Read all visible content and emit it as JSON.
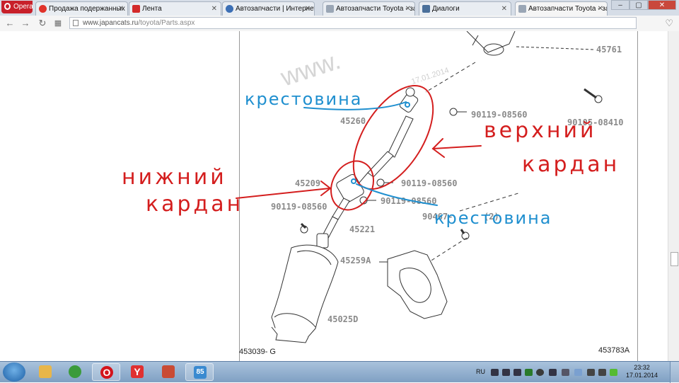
{
  "browser": {
    "menu_label": "Opera",
    "tabs": [
      {
        "title": "Продажа подержанных в",
        "icon": "drom-icon",
        "color": "#e0322a",
        "active": false
      },
      {
        "title": "Лента",
        "icon": "drive2-icon",
        "color": "#d32a2a",
        "active": false
      },
      {
        "title": "Автозапчасти | Интернет",
        "icon": "globe-icon",
        "color": "#3c6fb5",
        "active": false
      },
      {
        "title": "Автозапчасти Toyota - за",
        "icon": "page-icon",
        "color": "#9aa6b5",
        "active": false
      },
      {
        "title": "Диалоги",
        "icon": "vk-icon",
        "color": "#4a6f9a",
        "active": false
      },
      {
        "title": "Автозапчасти Toyota - за",
        "icon": "page-icon",
        "color": "#9aa6b5",
        "active": true
      }
    ],
    "address": {
      "host": "www.japancats.ru",
      "path": "/toyota/Parts.aspx"
    }
  },
  "diagram": {
    "watermark": "www.",
    "watermark_date": "17.01.2014",
    "part_numbers": {
      "p45761": "45761",
      "p45260": "45260",
      "p90119_a": "90119-08560",
      "p90105": "90105-08410",
      "p45209": "45209",
      "p90119_b": "90119-08560",
      "p90119_c": "90119-08560",
      "p90119_d": "90119-08560",
      "p90467": "90467-",
      "p90467_tail": "(2)",
      "p45221": "45221",
      "p45259A": "45259A",
      "p45025D": "45025D",
      "ref_left": "453039- G",
      "ref_right": "453783A"
    },
    "annotations": {
      "upper_cross": "крестовина",
      "upper_cardan_1": "верхний",
      "upper_cardan_2": "кардан",
      "lower_cardan_1": "нижний",
      "lower_cardan_2": "кардан",
      "lower_cross": "крестовина"
    },
    "colors": {
      "annotation_red": "#d41e1e",
      "annotation_blue": "#1f8fcf"
    }
  },
  "taskbar": {
    "apps": [
      {
        "name": "explorer",
        "icon": "folder-icon",
        "color": "#e8b64a",
        "glyph": ""
      },
      {
        "name": "chrome",
        "icon": "chrome-icon",
        "color": "#3b9b3b",
        "glyph": ""
      },
      {
        "name": "opera",
        "icon": "opera-icon",
        "color": "#d3141b",
        "glyph": "O"
      },
      {
        "name": "yandex",
        "icon": "yandex-browser-icon",
        "color": "#e03030",
        "glyph": "Y"
      },
      {
        "name": "app5",
        "icon": "app-icon",
        "color": "#c94b34",
        "glyph": ""
      },
      {
        "name": "app6",
        "icon": "app-icon",
        "color": "#3a8ad0",
        "glyph": "85"
      }
    ],
    "language": "RU",
    "time": "23:32",
    "date": "17.01.2014"
  }
}
